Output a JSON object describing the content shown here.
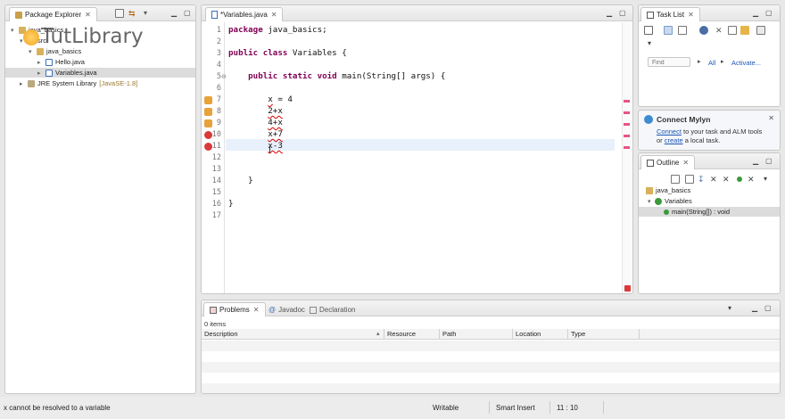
{
  "explorer": {
    "tab": "Package Explorer",
    "items": [
      {
        "label": "java_basics",
        "indent": 0,
        "open": true
      },
      {
        "label": "src",
        "indent": 1,
        "open": true
      },
      {
        "label": "java_basics",
        "indent": 2,
        "open": true
      },
      {
        "label": "Hello.java",
        "indent": 3,
        "open": false
      },
      {
        "label": "Variables.java",
        "indent": 3,
        "open": false
      },
      {
        "label": "JRE System Library",
        "suffix": "[JavaSE-1.8]",
        "indent": 1,
        "open": false
      }
    ],
    "watermark": "TutLibrary"
  },
  "editor": {
    "tab": "*Variables.java",
    "lines": [
      {
        "n": "1",
        "code": [
          [
            "package ",
            "kw"
          ],
          [
            "java_basics;",
            ""
          ]
        ]
      },
      {
        "n": "2",
        "code": []
      },
      {
        "n": "3",
        "code": [
          [
            "public class ",
            "kw"
          ],
          [
            "Variables {",
            ""
          ]
        ]
      },
      {
        "n": "4",
        "code": []
      },
      {
        "n": "5",
        "code": [
          [
            "    public static void ",
            "kw"
          ],
          [
            "main(String[] args) {",
            ""
          ]
        ]
      },
      {
        "n": "6",
        "code": []
      },
      {
        "n": "7",
        "code": [
          [
            "        ",
            ""
          ],
          [
            "x",
            "err"
          ],
          [
            " = 4",
            ""
          ]
        ],
        "marker": "warn"
      },
      {
        "n": "8",
        "code": [
          [
            "        ",
            ""
          ],
          [
            "2+x",
            "err"
          ]
        ],
        "marker": "warn"
      },
      {
        "n": "9",
        "code": [
          [
            "        ",
            ""
          ],
          [
            "4+x",
            "err"
          ]
        ],
        "marker": "warn"
      },
      {
        "n": "10",
        "code": [
          [
            "        ",
            ""
          ],
          [
            "x+7",
            "err"
          ]
        ],
        "marker": "error"
      },
      {
        "n": "11",
        "code": [
          [
            "        ",
            ""
          ],
          [
            "x-3",
            "err"
          ]
        ],
        "marker": "error"
      },
      {
        "n": "12",
        "code": []
      },
      {
        "n": "13",
        "code": []
      },
      {
        "n": "14",
        "code": [
          [
            "    }",
            ""
          ]
        ]
      },
      {
        "n": "15",
        "code": []
      },
      {
        "n": "16",
        "code": [
          [
            "}",
            ""
          ]
        ]
      },
      {
        "n": "17",
        "code": []
      }
    ]
  },
  "tasklist": {
    "tab": "Task List",
    "find_placeholder": "Find",
    "all": "All",
    "activate": "Activate..."
  },
  "mylyn": {
    "title": "Connect Mylyn",
    "connect_link": "Connect",
    "line1_rest": " to your task and ALM tools",
    "line2_prefix": "or ",
    "create_link": "create",
    "line2_rest": " a local task."
  },
  "outline": {
    "tab": "Outline",
    "items": [
      {
        "label": "java_basics",
        "indent": 0
      },
      {
        "label": "Variables",
        "indent": 1
      },
      {
        "label": "main(String[]) : void",
        "indent": 2
      }
    ]
  },
  "problems": {
    "tabs": [
      "Problems",
      "Javadoc",
      "Declaration"
    ],
    "count": "0 items",
    "columns": [
      "Description",
      "Resource",
      "Path",
      "Location",
      "Type"
    ]
  },
  "status": {
    "message": "x cannot be resolved to a variable",
    "writable": "Writable",
    "insert": "Smart Insert",
    "position": "11 : 10"
  },
  "colors": {
    "error": "#d93a3a",
    "warning": "#e8a23a",
    "link": "#1a56b5",
    "highlight": "#e8f0fb"
  }
}
